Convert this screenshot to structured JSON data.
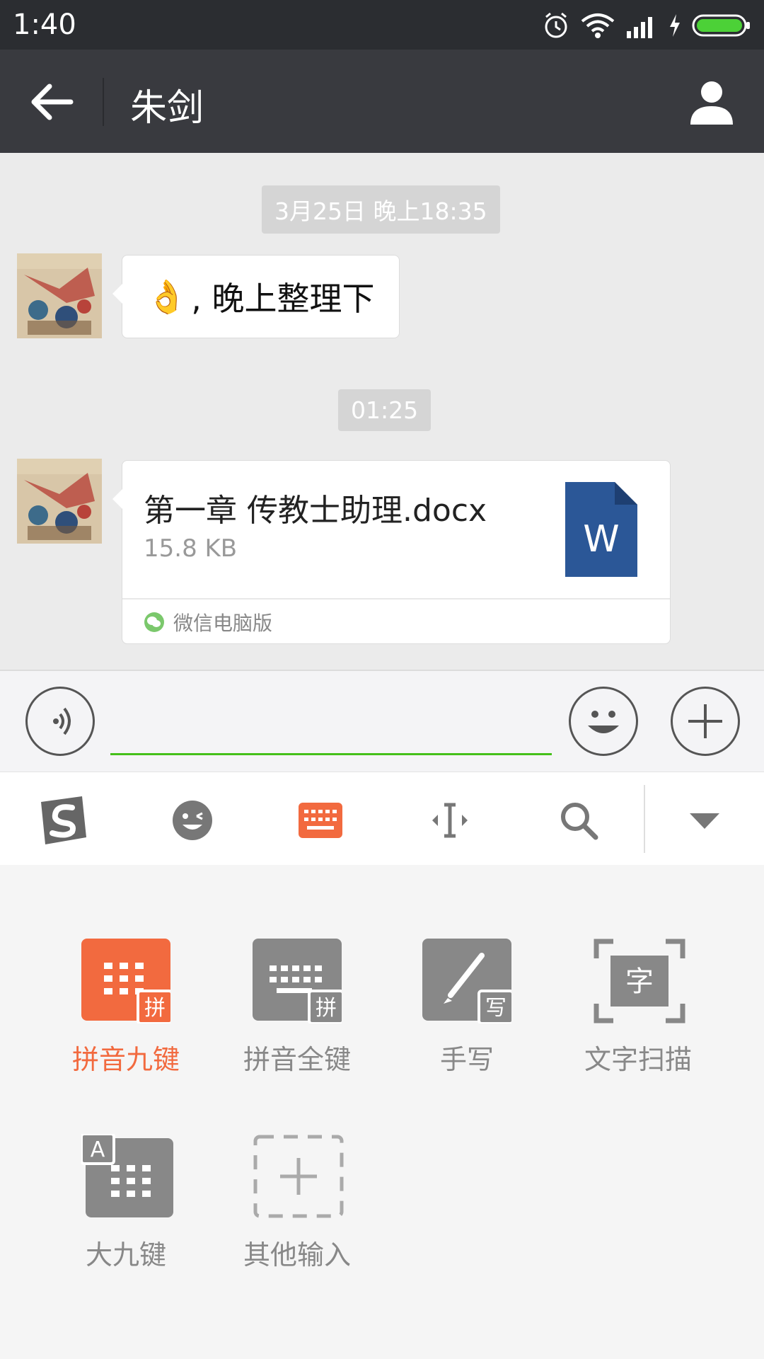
{
  "status_bar": {
    "time": "1:40"
  },
  "title_bar": {
    "title": "朱剑"
  },
  "chat": {
    "timestamps": [
      "3月25日 晚上18:35",
      "01:25"
    ],
    "text_message": {
      "emoji": "👌",
      "text": ", 晚上整理下"
    },
    "file_message": {
      "file_name": "第一章 传教士助理.docx",
      "file_size": "15.8 KB",
      "icon_letter": "W",
      "source": "微信电脑版"
    }
  },
  "input_bar": {
    "value": ""
  },
  "ime_options": [
    {
      "label": "拼音九键",
      "badge": "拼",
      "active": true
    },
    {
      "label": "拼音全键",
      "badge": "拼",
      "active": false
    },
    {
      "label": "手写",
      "badge": "写",
      "active": false
    },
    {
      "label": "文字扫描",
      "badge": "字",
      "active": false
    },
    {
      "label": "大九键",
      "badge": "A",
      "active": false
    },
    {
      "label": "其他输入",
      "badge": "",
      "active": false
    }
  ],
  "colors": {
    "accent": "#f26a3f",
    "green": "#45c01a",
    "titlebar": "#393a3f",
    "word_blue": "#2b5797"
  }
}
